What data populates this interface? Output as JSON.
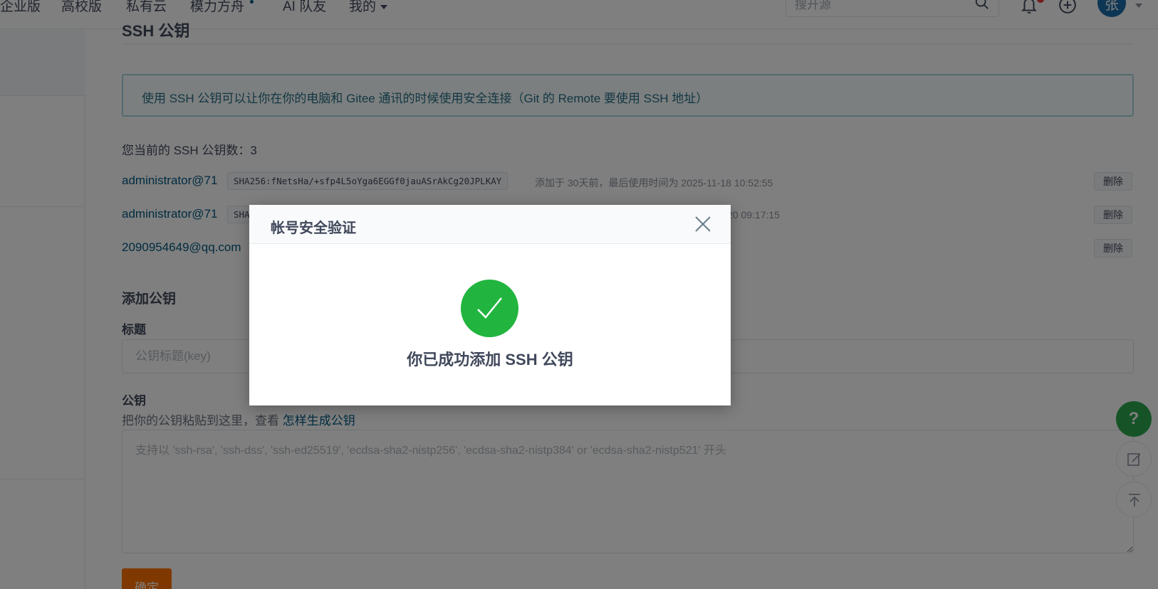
{
  "nav": {
    "items": [
      "企业版",
      "高校版",
      "私有云",
      "模力方舟",
      "AI 队友",
      "我的"
    ],
    "search_placeholder": "搜开源",
    "avatar_text": "张"
  },
  "page": {
    "title": "SSH 公钥",
    "info": "使用 SSH 公钥可以让你在你的电脑和 Gitee 通讯的时候使用安全连接（Git 的 Remote 要使用 SSH 地址）",
    "count_label": "您当前的 SSH 公钥数：",
    "count_value": "3"
  },
  "keys": [
    {
      "title": "administrator@71",
      "fingerprint": "SHA256:fNetsHa/+sfp4L5oYga6EGGf0jauASrAkCg20JPLKAY",
      "meta": "添加于 30天前，最后使用时间为 2025-11-18 10:52:55",
      "delete_label": "删除"
    },
    {
      "title": "administrator@71",
      "fingerprint": "SHA",
      "meta": "20 09:17:15",
      "delete_label": "删除"
    },
    {
      "title": "2090954649@qq.com",
      "delete_label": "删除"
    }
  ],
  "form": {
    "section_title": "添加公钥",
    "title_label": "标题",
    "title_placeholder": "公钥标题(key)",
    "key_label": "公钥",
    "help_prefix": "把你的公钥粘贴到这里，查看 ",
    "help_link": "怎样生成公钥",
    "key_placeholder": "支持以 'ssh-rsa', 'ssh-dss', 'ssh-ed25519', 'ecdsa-sha2-nistp256', 'ecdsa-sha2-nistp384' or 'ecdsa-sha2-nistp521' 开头",
    "submit_label": "确定"
  },
  "float": {
    "help_label": "?"
  },
  "modal": {
    "title": "帐号安全验证",
    "message": "你已成功添加 SSH 公钥"
  },
  "colors": {
    "accent_orange": "#fe7300",
    "link_blue": "#005980",
    "success_green": "#21b53f",
    "avatar_blue": "#1b6ca8"
  }
}
